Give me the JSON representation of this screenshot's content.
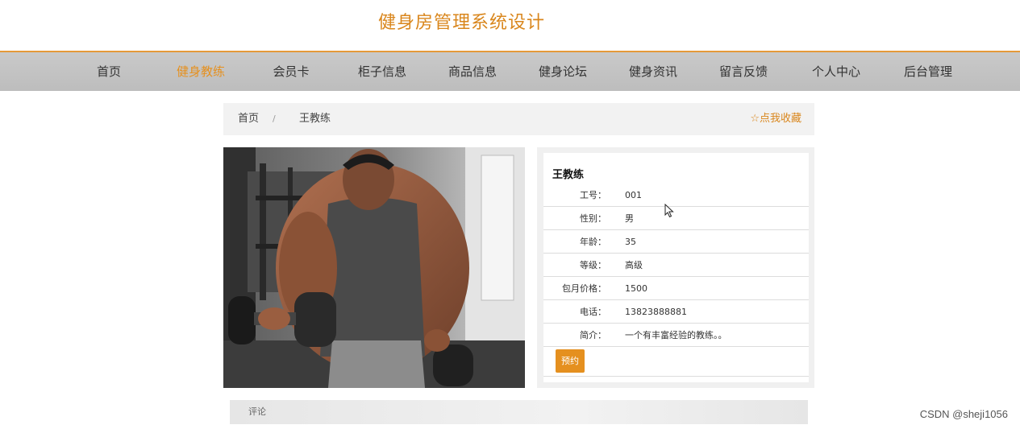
{
  "site": {
    "title": "健身房管理系统设计"
  },
  "nav": {
    "items": [
      {
        "label": "首页",
        "active": false
      },
      {
        "label": "健身教练",
        "active": true
      },
      {
        "label": "会员卡",
        "active": false
      },
      {
        "label": "柜子信息",
        "active": false
      },
      {
        "label": "商品信息",
        "active": false
      },
      {
        "label": "健身论坛",
        "active": false
      },
      {
        "label": "健身资讯",
        "active": false
      },
      {
        "label": "留言反馈",
        "active": false
      },
      {
        "label": "个人中心",
        "active": false
      },
      {
        "label": "后台管理",
        "active": false
      }
    ]
  },
  "breadcrumb": {
    "home": "首页",
    "separator": "/",
    "current": "王教练"
  },
  "favorite": {
    "label": "☆点我收藏"
  },
  "coach": {
    "name": "王教练",
    "fields": [
      {
        "label": "工号：",
        "value": "001"
      },
      {
        "label": "性别：",
        "value": "男"
      },
      {
        "label": "年龄：",
        "value": "35"
      },
      {
        "label": "等级：",
        "value": "高级"
      },
      {
        "label": "包月价格：",
        "value": "1500"
      },
      {
        "label": "电话：",
        "value": "13823888881"
      },
      {
        "label": "简介：",
        "value": "一个有丰富经验的教练。。"
      }
    ],
    "book_label": "预约"
  },
  "comments": {
    "label": "评论"
  },
  "watermark": "CSDN @sheji1056",
  "colors": {
    "accent": "#e5901f",
    "title": "#d9861c",
    "navbar": "#c4c4c4"
  }
}
